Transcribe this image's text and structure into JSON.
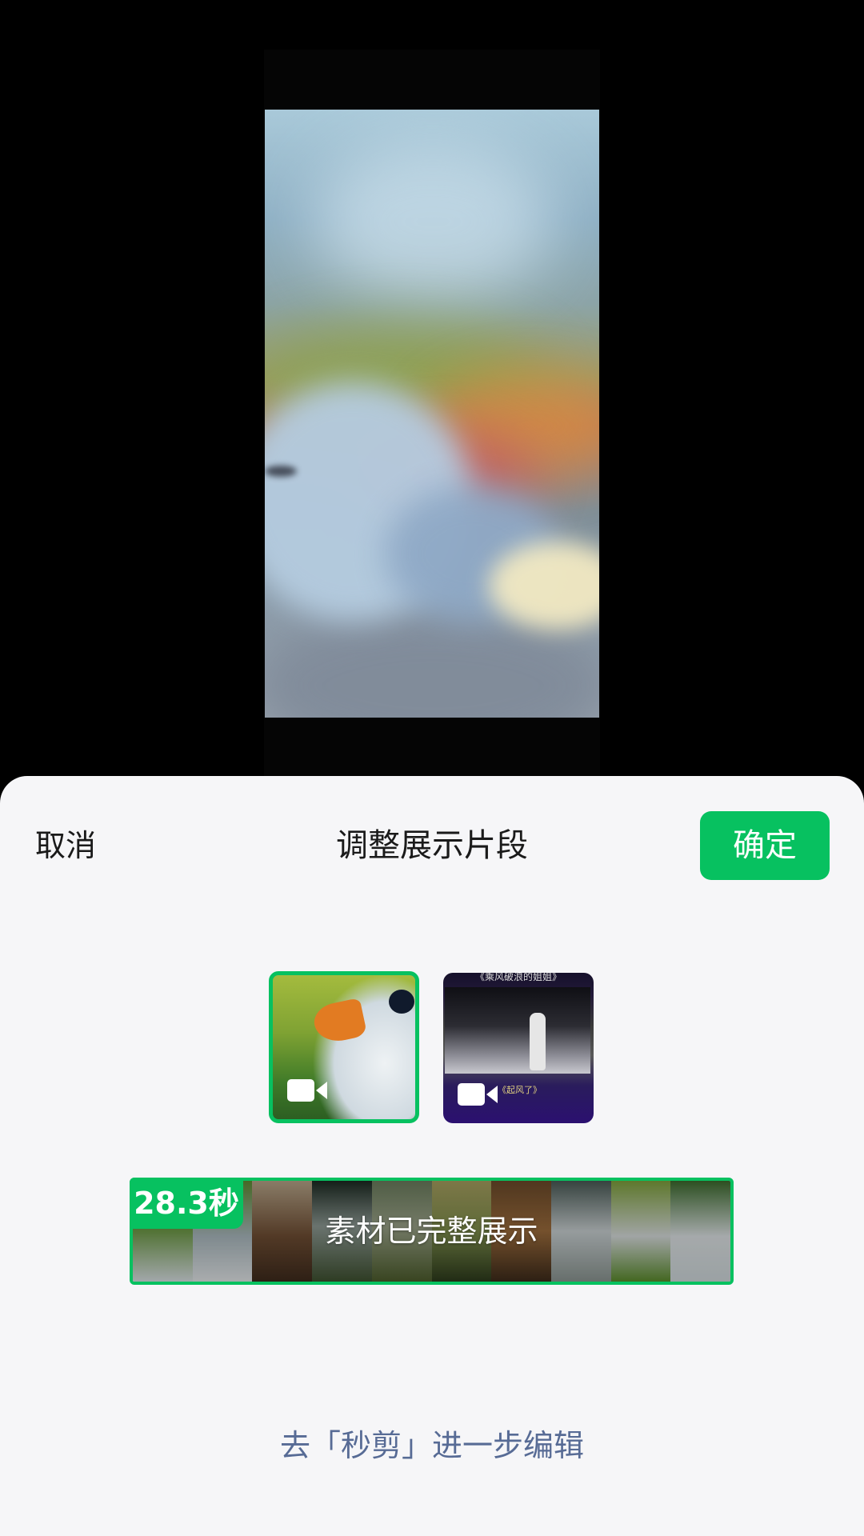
{
  "header": {
    "cancel_label": "取消",
    "title": "调整展示片段",
    "confirm_label": "确定"
  },
  "materials": {
    "selected_index": 0,
    "items": [
      {
        "type": "video",
        "icon": "video-camera-icon"
      },
      {
        "type": "video",
        "icon": "video-camera-icon",
        "top_caption": "《乘风破浪的姐姐》",
        "bottom_caption": "《起风了》"
      }
    ]
  },
  "timeline": {
    "duration": "28.3秒",
    "status_text": "素材已完整展示",
    "frames": 10
  },
  "footer": {
    "edit_link": "去「秒剪」进一步编辑"
  },
  "colors": {
    "accent": "#07c160",
    "link": "#576b95",
    "sheet_bg": "#f6f6f8",
    "preview_bg": "#000000"
  }
}
